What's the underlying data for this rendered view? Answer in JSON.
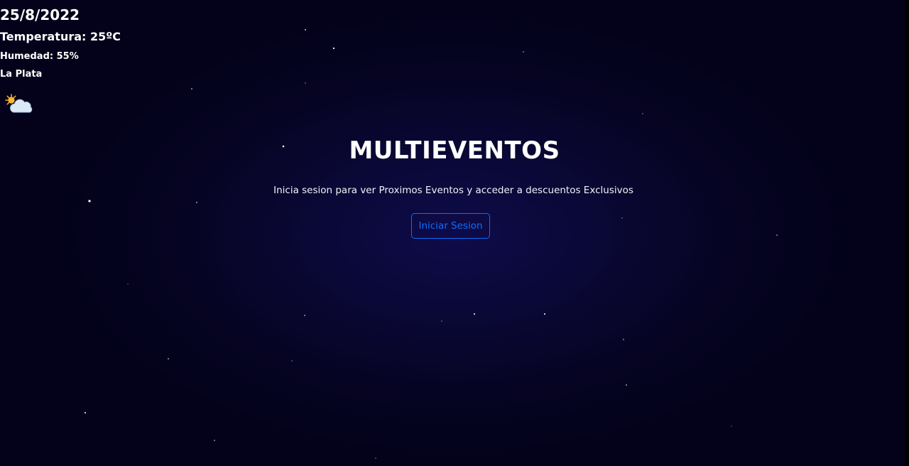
{
  "weather": {
    "date": "25/8/2022",
    "temperature": "Temperatura: 25ºC",
    "humidity": "Humedad: 55%",
    "city": "La Plata",
    "icon": "partly-cloudy-icon"
  },
  "hero": {
    "title": "MULTIEVENTOS",
    "subtitle": "Inicia sesion para ver Proximos Eventos y acceder a descuentos Exclusivos",
    "login_label": "Iniciar Sesion"
  },
  "colors": {
    "background": "#03021a",
    "glow": "#0e0b4a",
    "button_accent": "#0d6efd",
    "text": "#ffffff"
  }
}
